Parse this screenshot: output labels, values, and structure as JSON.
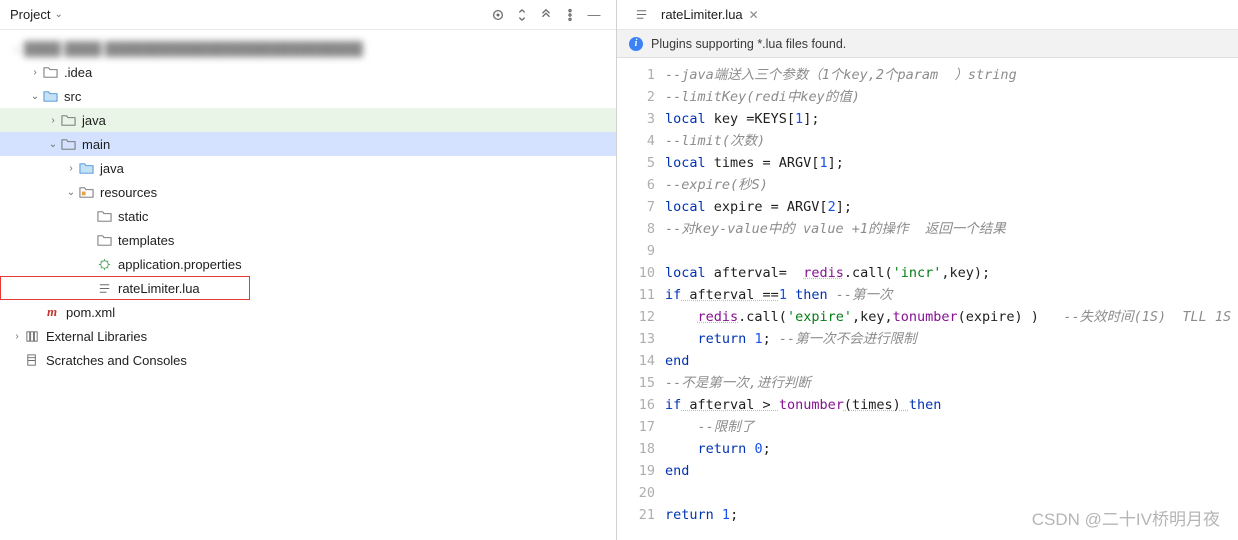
{
  "project_panel": {
    "title": "Project",
    "tree": {
      "blurred_root": "████ ████ ████████████████████████████",
      "idea": ".idea",
      "src": "src",
      "java1": "java",
      "main": "main",
      "java2": "java",
      "resources": "resources",
      "static": "static",
      "templates": "templates",
      "app_props": "application.properties",
      "lua": "rateLimiter.lua",
      "pom": "pom.xml",
      "ext_lib": "External Libraries",
      "scratches": "Scratches and Consoles"
    }
  },
  "editor": {
    "tab_label": "rateLimiter.lua",
    "notification": "Plugins supporting *.lua files found.",
    "lines": {
      "l1_com": "--java端送入三个参数（1个key,2个param  ）string",
      "l2_com": "--limitKey(redi中key的值)",
      "l3_a": "local",
      "l3_b": " key =KEYS[",
      "l3_c": "1",
      "l3_d": "];",
      "l4_com": "--limit(次数)",
      "l5_a": "local",
      "l5_b": " times = ARGV[",
      "l5_c": "1",
      "l5_d": "];",
      "l6_com": "--expire(秒S)",
      "l7_a": "local",
      "l7_b": " expire = ARGV[",
      "l7_c": "2",
      "l7_d": "];",
      "l8_com": "--对key-value中的 value +1的操作  返回一个结果",
      "l10_a": "local",
      "l10_b": " afterval=  ",
      "l10_c": "redis",
      "l10_d": ".call(",
      "l10_e": "'incr'",
      "l10_f": ",key);",
      "l11_a": "if",
      "l11_b": " afterval ==",
      "l11_c": "1",
      "l11_d": " ",
      "l11_e": "then",
      "l11_f": " ",
      "l11_g": "--第一次",
      "l12_a": "    ",
      "l12_b": "redis",
      "l12_c": ".call(",
      "l12_d": "'expire'",
      "l12_e": ",key,",
      "l12_f": "tonumber",
      "l12_g": "(expire) )   ",
      "l12_h": "--失效时间(1S)  TLL 1S",
      "l13_a": "    ",
      "l13_b": "return",
      "l13_c": " ",
      "l13_d": "1",
      "l13_e": "; ",
      "l13_f": "--第一次不会进行限制",
      "l14": "end",
      "l15_com": "--不是第一次,进行判断",
      "l16_a": "if",
      "l16_b": " afterval > ",
      "l16_c": "tonumber",
      "l16_d": "(times) ",
      "l16_e": "then",
      "l17_a": "    ",
      "l17_b": "--限制了",
      "l18_a": "    ",
      "l18_b": "return",
      "l18_c": " ",
      "l18_d": "0",
      "l18_e": ";",
      "l19": "end",
      "l21_a": "return",
      "l21_b": " ",
      "l21_c": "1",
      "l21_d": ";"
    }
  },
  "watermark": "CSDN @二十IV桥明月夜"
}
